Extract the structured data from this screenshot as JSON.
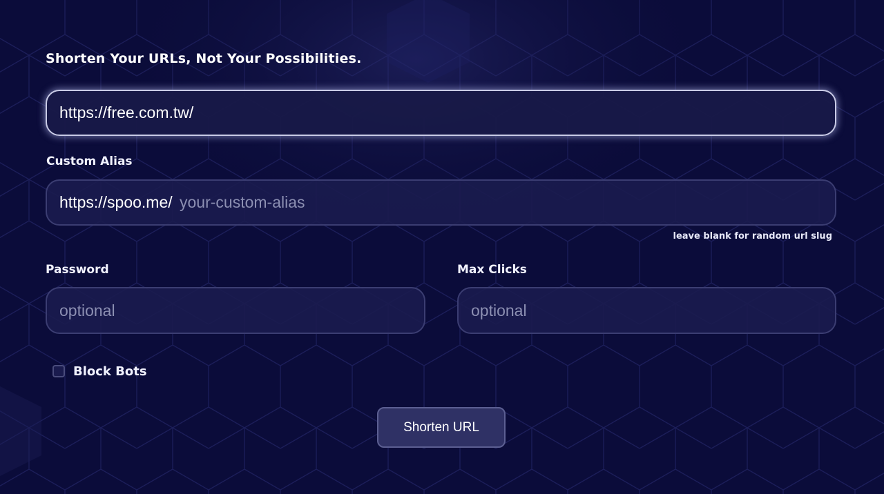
{
  "heading": "Shorten Your URLs, Not Your Possibilities.",
  "url_input": {
    "value": "https://free.com.tw/",
    "placeholder": ""
  },
  "custom_alias": {
    "label": "Custom Alias",
    "prefix": "https://spoo.me/",
    "placeholder": "your-custom-alias",
    "value": "",
    "hint": "leave blank for random url slug"
  },
  "password": {
    "label": "Password",
    "placeholder": "optional",
    "value": ""
  },
  "max_clicks": {
    "label": "Max Clicks",
    "placeholder": "optional",
    "value": ""
  },
  "block_bots": {
    "label": "Block Bots",
    "checked": false
  },
  "submit_button": {
    "label": "Shorten URL"
  },
  "colors": {
    "background": "#0b0c3a",
    "field_background": "#1a1b4e",
    "field_border": "#3b3d72",
    "focus_border": "#c9cbe6",
    "placeholder": "#8c8fb2",
    "button_background": "#2f3165"
  }
}
